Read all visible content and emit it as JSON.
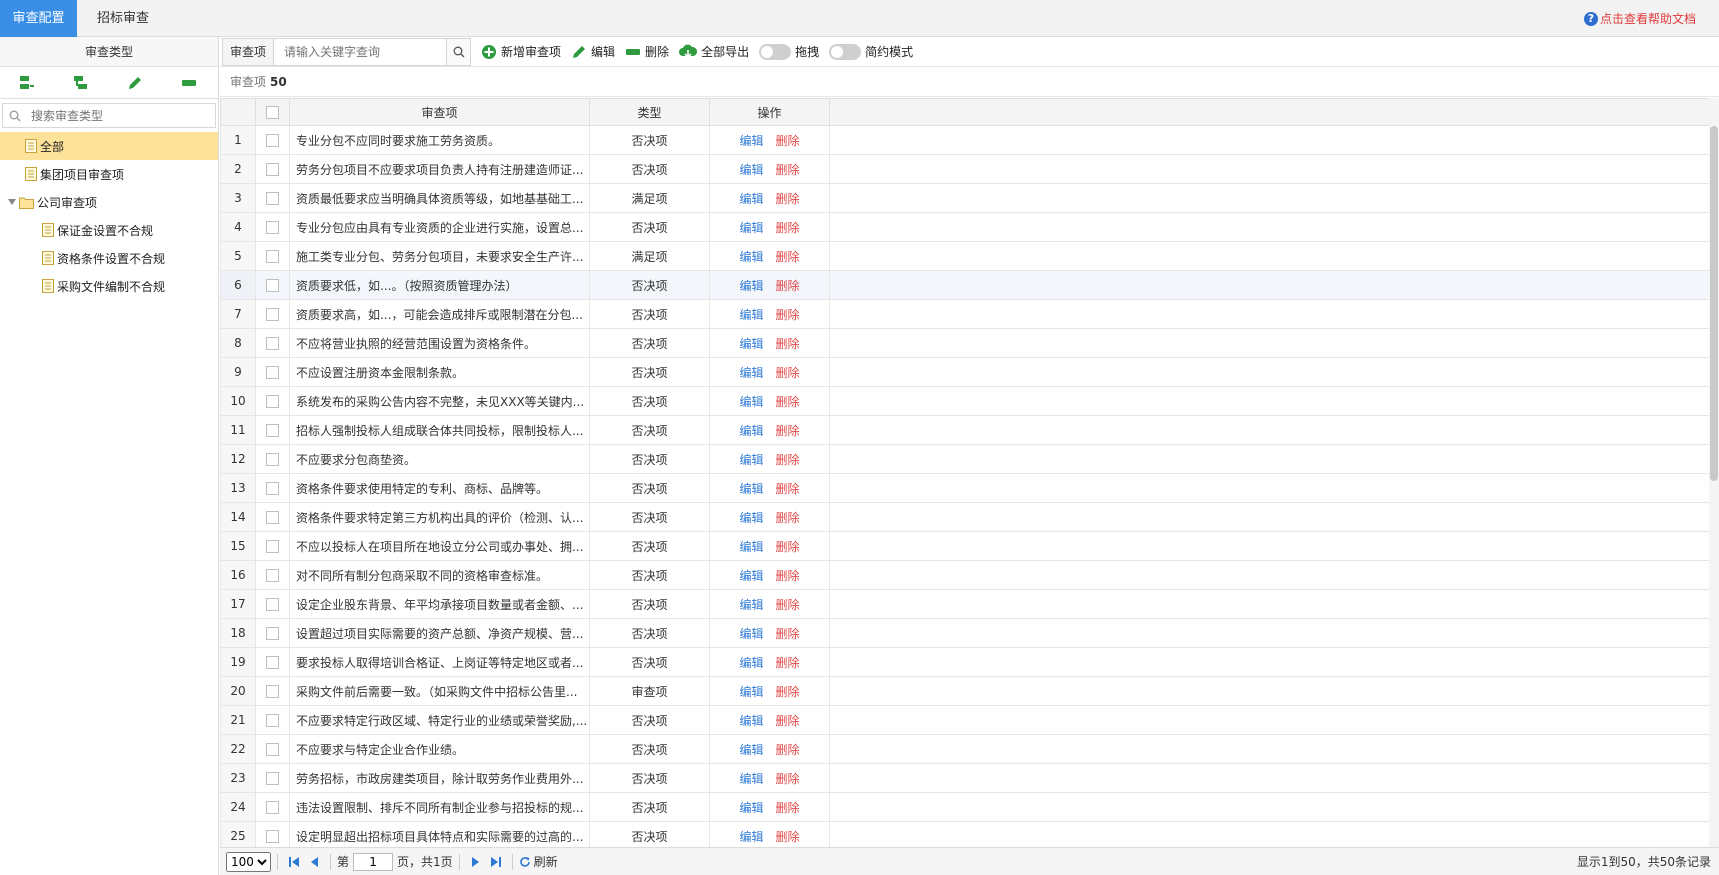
{
  "topbar": {
    "tabs": [
      {
        "label": "审查配置",
        "active": true
      },
      {
        "label": "招标审查",
        "active": false
      }
    ],
    "help_text": "点击查看帮助文档",
    "help_icon": "question-circle-icon",
    "accent": "#3a8ee6"
  },
  "left_panel": {
    "title": "审查类型",
    "tools": [
      "add-sibling-icon",
      "add-child-icon",
      "edit-icon",
      "delete-icon"
    ],
    "search_placeholder": "搜索审查类型",
    "tree": {
      "all": "全部",
      "group": "集团项目审查项",
      "company": "公司审查项",
      "children": [
        "保证金设置不合规",
        "资格条件设置不合规",
        "采购文件编制不合规"
      ]
    }
  },
  "toolbar": {
    "field_label": "审查项",
    "keyword_placeholder": "请输入关键字查询",
    "add_label": "新增审查项",
    "edit_label": "编辑",
    "delete_label": "删除",
    "export_label": "全部导出",
    "drag_label": "拖拽",
    "simple_label": "简约模式"
  },
  "count": {
    "label": "审查项",
    "value": "50"
  },
  "table": {
    "headers": {
      "name": "审查项",
      "type": "类型",
      "ops": "操作"
    },
    "edit_text": "编辑",
    "delete_text": "删除",
    "rows": [
      {
        "no": "1",
        "name": "专业分包不应同时要求施工劳务资质。",
        "type": "否决项"
      },
      {
        "no": "2",
        "name": "劳务分包项目不应要求项目负责人持有注册建造师证...",
        "type": "否决项"
      },
      {
        "no": "3",
        "name": "资质最低要求应当明确具体资质等级，如地基基础工...",
        "type": "满足项"
      },
      {
        "no": "4",
        "name": "专业分包应由具有专业资质的企业进行实施，设置总...",
        "type": "否决项"
      },
      {
        "no": "5",
        "name": "施工类专业分包、劳务分包项目，未要求安全生产许...",
        "type": "满足项"
      },
      {
        "no": "6",
        "name": "资质要求低，如...。（按照资质管理办法）",
        "type": "否决项"
      },
      {
        "no": "7",
        "name": "资质要求高，如...，可能会造成排斥或限制潜在分包...",
        "type": "否决项"
      },
      {
        "no": "8",
        "name": "不应将营业执照的经营范围设置为资格条件。",
        "type": "否决项"
      },
      {
        "no": "9",
        "name": "不应设置注册资本金限制条款。",
        "type": "否决项"
      },
      {
        "no": "10",
        "name": "系统发布的采购公告内容不完整，未见XXX等关键内...",
        "type": "否决项"
      },
      {
        "no": "11",
        "name": "招标人强制投标人组成联合体共同投标，限制投标人...",
        "type": "否决项"
      },
      {
        "no": "12",
        "name": "不应要求分包商垫资。",
        "type": "否决项"
      },
      {
        "no": "13",
        "name": "资格条件要求使用特定的专利、商标、品牌等。",
        "type": "否决项"
      },
      {
        "no": "14",
        "name": "资格条件要求特定第三方机构出具的评价（检测、认...",
        "type": "否决项"
      },
      {
        "no": "15",
        "name": "不应以投标人在项目所在地设立分公司或办事处、拥...",
        "type": "否决项"
      },
      {
        "no": "16",
        "name": "对不同所有制分包商采取不同的资格审查标准。",
        "type": "否决项"
      },
      {
        "no": "17",
        "name": "设定企业股东背景、年平均承接项目数量或者金额、...",
        "type": "否决项"
      },
      {
        "no": "18",
        "name": "设置超过项目实际需要的资产总额、净资产规模、营...",
        "type": "否决项"
      },
      {
        "no": "19",
        "name": "要求投标人取得培训合格证、上岗证等特定地区或者...",
        "type": "否决项"
      },
      {
        "no": "20",
        "name": "采购文件前后需要一致。（如采购文件中招标公告里...",
        "type": "审查项"
      },
      {
        "no": "21",
        "name": "不应要求特定行政区域、特定行业的业绩或荣誉奖励,...",
        "type": "否决项"
      },
      {
        "no": "22",
        "name": "不应要求与特定企业合作业绩。",
        "type": "否决项"
      },
      {
        "no": "23",
        "name": "劳务招标，市政房建类项目，除计取劳务作业费用外...",
        "type": "否决项"
      },
      {
        "no": "24",
        "name": "违法设置限制、排斥不同所有制企业参与招投标的规...",
        "type": "否决项"
      },
      {
        "no": "25",
        "name": "设定明显超出招标项目具体特点和实际需要的过高的...",
        "type": "否决项"
      }
    ]
  },
  "pager": {
    "page_size": "100",
    "page_prefix": "第",
    "page_value": "1",
    "page_suffix": "页，共1页",
    "refresh_label": "刷新",
    "info": "显示1到50，共50条记录"
  }
}
